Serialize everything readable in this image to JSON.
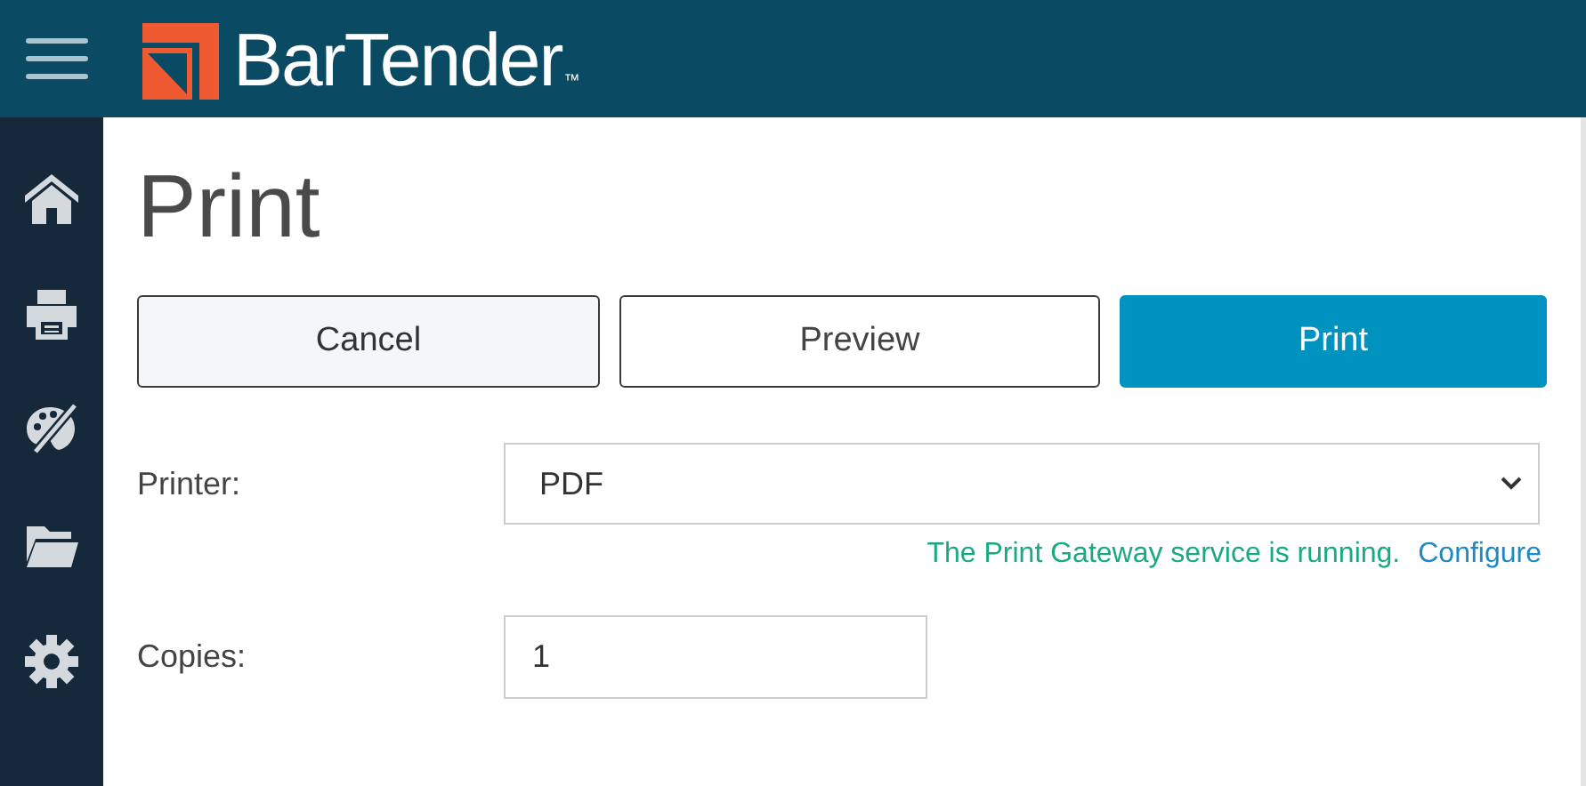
{
  "header": {
    "brand": "BarTender",
    "trademark": "™"
  },
  "sidebar": {
    "items": [
      {
        "kind": "home"
      },
      {
        "kind": "printer"
      },
      {
        "kind": "palette"
      },
      {
        "kind": "folder"
      },
      {
        "kind": "settings"
      }
    ]
  },
  "page": {
    "title": "Print"
  },
  "buttons": [
    {
      "label": "Cancel",
      "kind": "secondary"
    },
    {
      "label": "Preview",
      "kind": "outline"
    },
    {
      "label": "Print",
      "kind": "primary"
    }
  ],
  "printer": {
    "label": "Printer:",
    "value": "PDF",
    "status": "The Print Gateway service is running.",
    "link": "Configure"
  },
  "copies": {
    "label": "Copies:",
    "value": "1"
  }
}
